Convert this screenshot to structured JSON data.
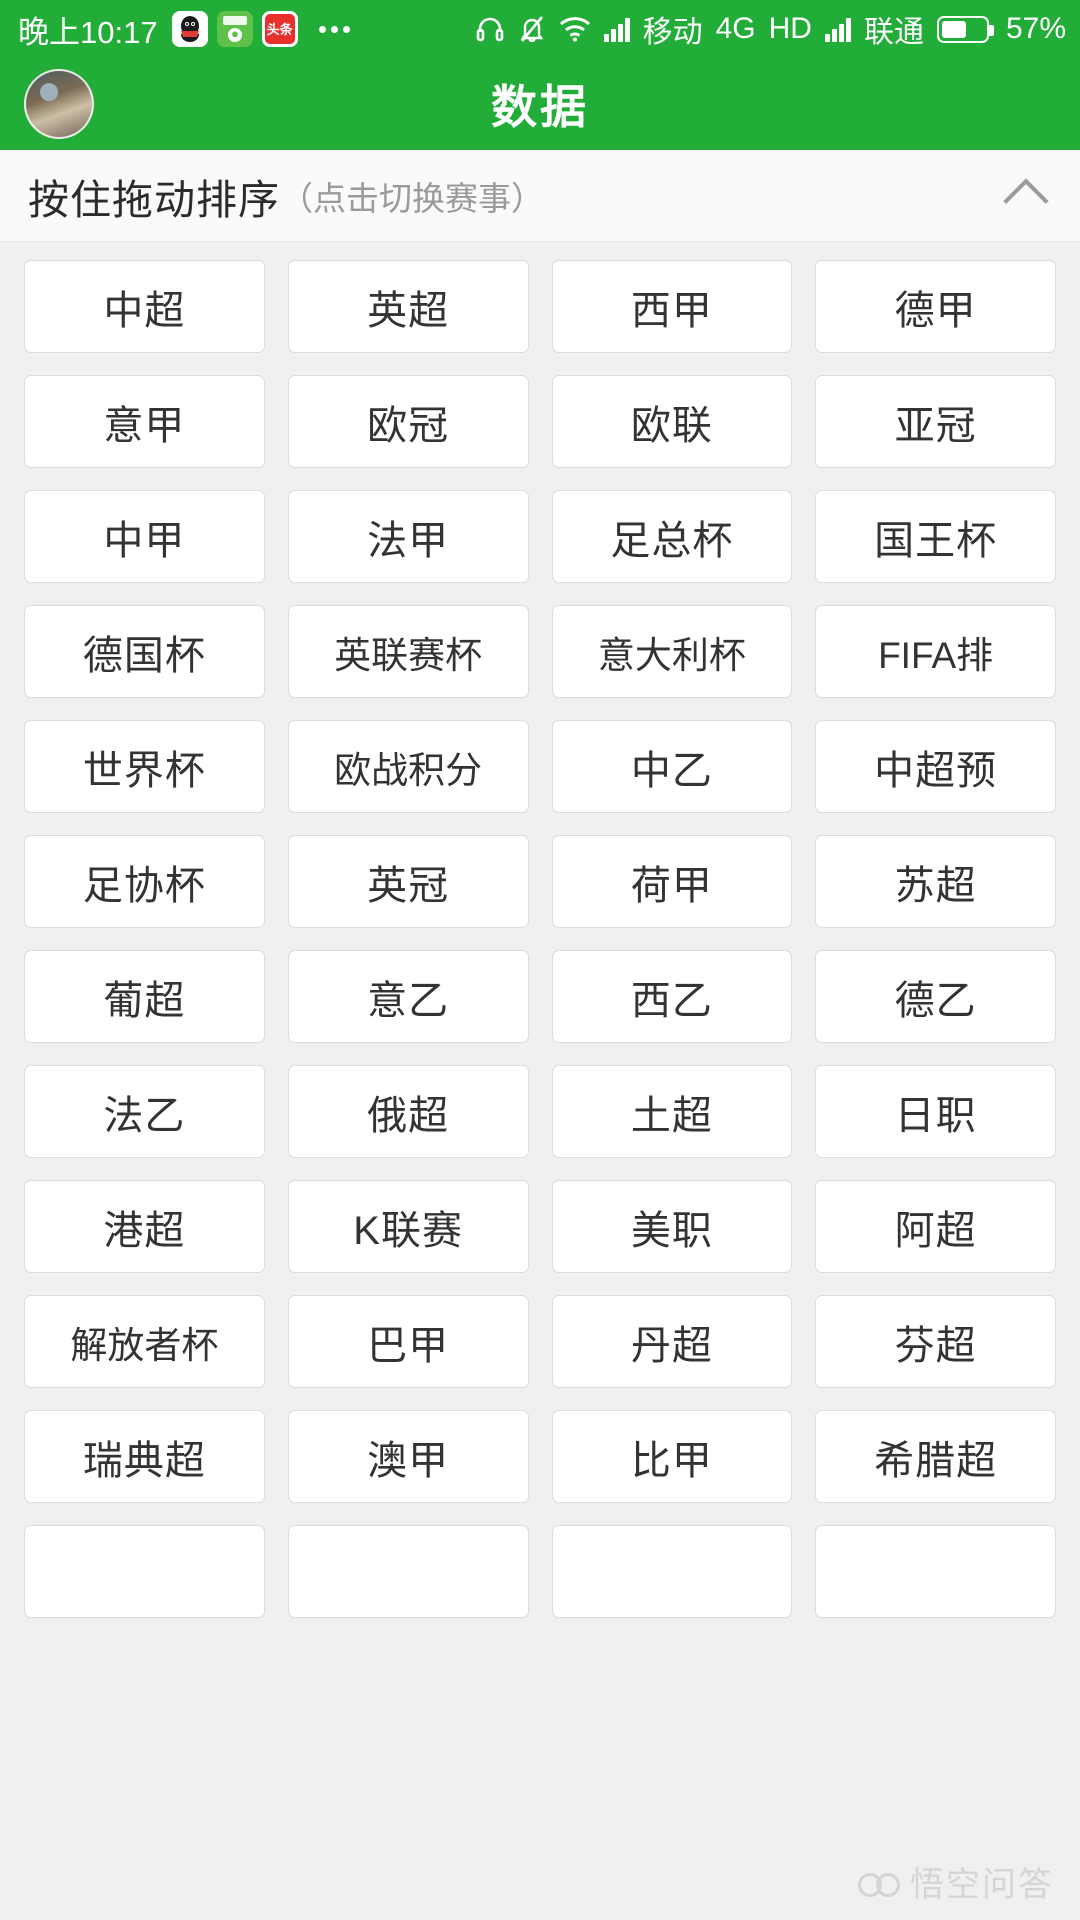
{
  "status_bar": {
    "time": "晚上10:17",
    "app_icons": [
      {
        "name": "qq-icon",
        "glyph": "🐧"
      },
      {
        "name": "soccer-app-icon",
        "glyph": "⚽"
      },
      {
        "name": "toutiao-icon",
        "glyph": "头条"
      }
    ],
    "more_label": "...",
    "headset_icon": "headset-icon",
    "mute_bell_icon": "bell-muted-icon",
    "wifi_icon": "wifi-icon",
    "carrier_1": "移动",
    "network_type": "4G",
    "hd_label": "HD",
    "carrier_2": "联通",
    "battery_percent": "57%",
    "battery_level": 57
  },
  "app_bar": {
    "title": "数据",
    "avatar_name": "user-avatar"
  },
  "sort_bar": {
    "main_text": "按住拖动排序",
    "sub_text": "（点击切换赛事）",
    "collapse_icon": "chevron-up-icon"
  },
  "grid": {
    "columns": 4,
    "tiles": [
      "中超",
      "英超",
      "西甲",
      "德甲",
      "意甲",
      "欧冠",
      "欧联",
      "亚冠",
      "中甲",
      "法甲",
      "足总杯",
      "国王杯",
      "德国杯",
      "英联赛杯",
      "意大利杯",
      "FIFA排",
      "世界杯",
      "欧战积分",
      "中乙",
      "中超预",
      "足协杯",
      "英冠",
      "荷甲",
      "苏超",
      "葡超",
      "意乙",
      "西乙",
      "德乙",
      "法乙",
      "俄超",
      "土超",
      "日职",
      "港超",
      "K联赛",
      "美职",
      "阿超",
      "解放者杯",
      "巴甲",
      "丹超",
      "芬超",
      "瑞典超",
      "澳甲",
      "比甲",
      "希腊超",
      "",
      "",
      "",
      ""
    ]
  },
  "watermark": {
    "text": "悟空问答",
    "logo_name": "wukong-logo-icon"
  },
  "colors": {
    "brand_green": "#22ac38",
    "page_background": "#f0f0f0",
    "tile_background": "#ffffff",
    "tile_border": "#dcdcdc",
    "primary_text": "#333333",
    "muted_text": "#9a9a9a"
  }
}
